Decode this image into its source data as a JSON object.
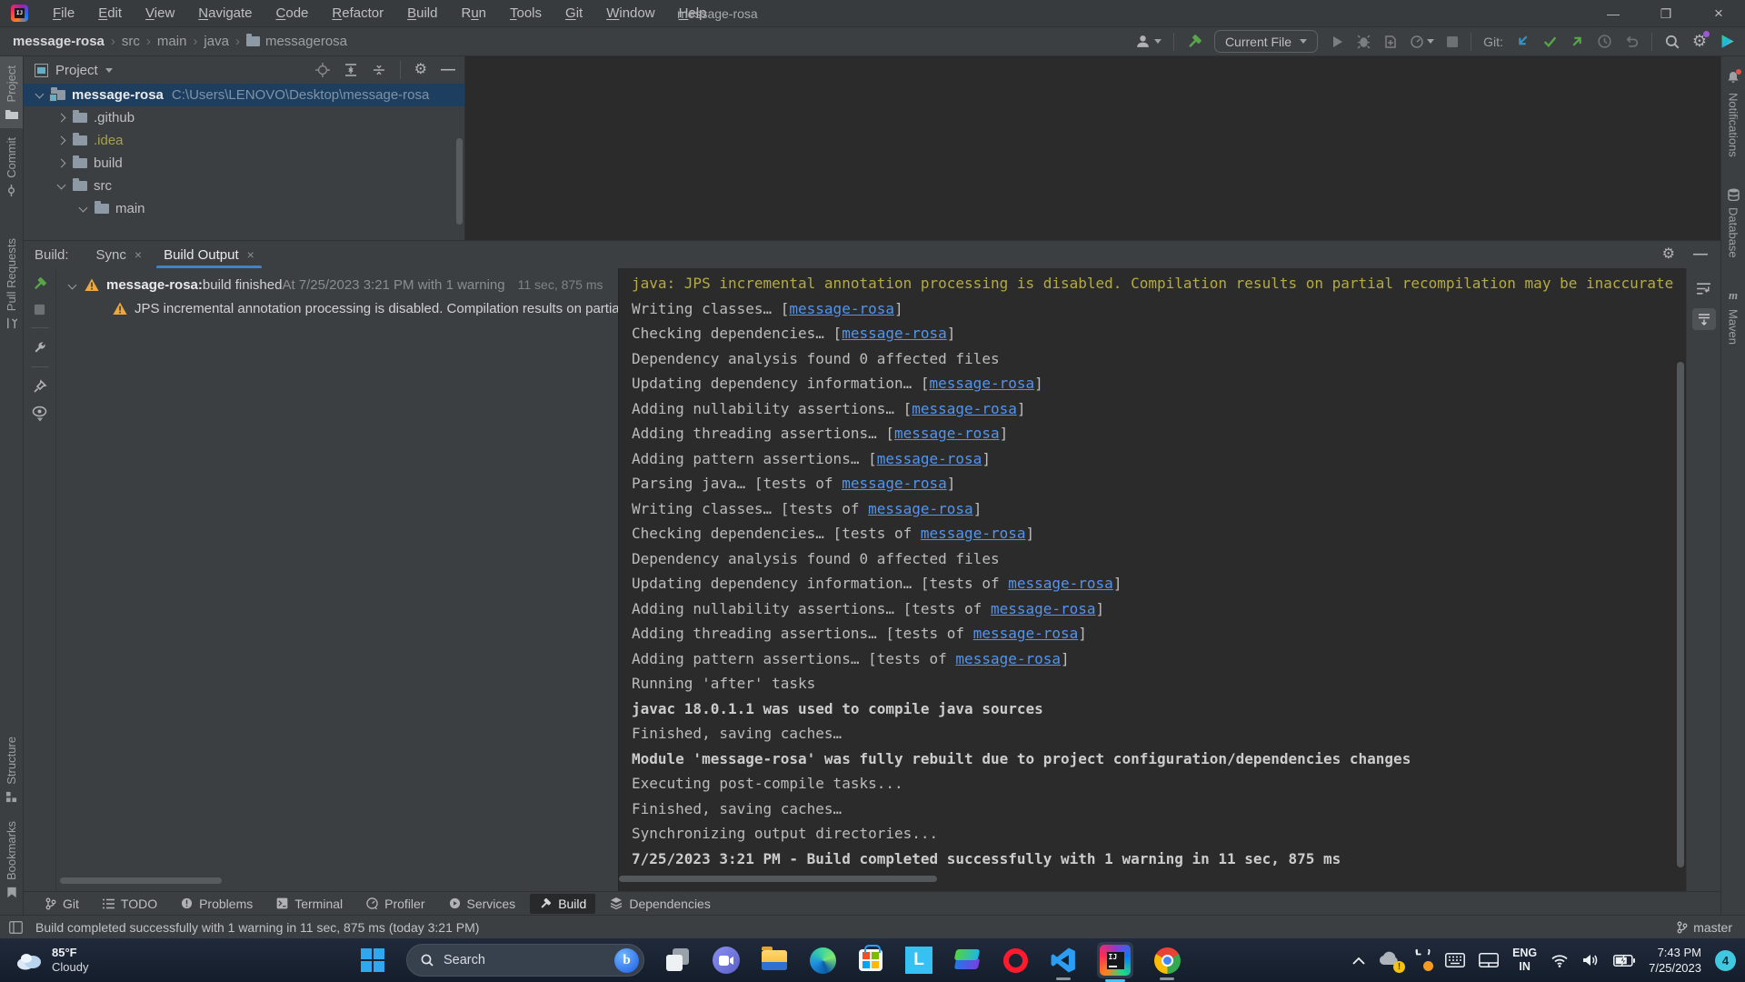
{
  "window": {
    "title": "message-rosa",
    "controls": {
      "minimize": "—",
      "maximize": "❐",
      "close": "×"
    }
  },
  "menu": {
    "items": [
      {
        "label": "File",
        "m": 0
      },
      {
        "label": "Edit",
        "m": 0
      },
      {
        "label": "View",
        "m": 0
      },
      {
        "label": "Navigate",
        "m": 0
      },
      {
        "label": "Code",
        "m": 0
      },
      {
        "label": "Refactor",
        "m": 0
      },
      {
        "label": "Build",
        "m": 0
      },
      {
        "label": "Run",
        "m": 1
      },
      {
        "label": "Tools",
        "m": 0
      },
      {
        "label": "Git",
        "m": 0
      },
      {
        "label": "Window",
        "m": 0
      },
      {
        "label": "Help",
        "m": 0
      }
    ]
  },
  "breadcrumbs": {
    "items": [
      "message-rosa",
      "src",
      "main",
      "java",
      "messagerosa"
    ]
  },
  "toolbar": {
    "run_config": "Current File",
    "git_label": "Git:"
  },
  "left_stripe": {
    "items": [
      "Project",
      "Commit",
      "Pull Requests",
      "Structure",
      "Bookmarks"
    ]
  },
  "right_stripe": {
    "items": [
      "Notifications",
      "Database",
      "Maven"
    ]
  },
  "project_panel": {
    "title": "Project",
    "tree": [
      {
        "label": "message-rosa",
        "path": "C:\\Users\\LENOVO\\Desktop\\message-rosa",
        "indent": 0,
        "chevron": "open",
        "selected": true,
        "bold": true,
        "root": true
      },
      {
        "label": ".github",
        "indent": 1,
        "chevron": "closed"
      },
      {
        "label": ".idea",
        "indent": 1,
        "chevron": "closed",
        "special": true
      },
      {
        "label": "build",
        "indent": 1,
        "chevron": "closed"
      },
      {
        "label": "src",
        "indent": 1,
        "chevron": "open"
      },
      {
        "label": "main",
        "indent": 2,
        "chevron": "open"
      }
    ]
  },
  "build_panel": {
    "label": "Build:",
    "tabs": [
      {
        "label": "Sync",
        "close": "×"
      },
      {
        "label": "Build Output",
        "close": "×",
        "selected": true
      }
    ],
    "tree": {
      "row1_bold": "message-rosa:",
      "row1_normal": " build finished",
      "row1_meta": " At 7/25/2023 3:21 PM with 1 warning",
      "row1_duration": "11 sec, 875 ms",
      "row2_text": "JPS incremental annotation processing is disabled. Compilation results on partia"
    },
    "console": [
      {
        "style": "warn",
        "parts": [
          {
            "t": "java: JPS incremental annotation processing is disabled. Compilation results on partial recompilation may be inaccurate"
          }
        ]
      },
      {
        "parts": [
          {
            "t": "Writing classes… ["
          },
          {
            "l": "message-rosa"
          },
          {
            "t": "]"
          }
        ]
      },
      {
        "parts": [
          {
            "t": "Checking dependencies… ["
          },
          {
            "l": "message-rosa"
          },
          {
            "t": "]"
          }
        ]
      },
      {
        "parts": [
          {
            "t": "Dependency analysis found 0 affected files"
          }
        ]
      },
      {
        "parts": [
          {
            "t": "Updating dependency information… ["
          },
          {
            "l": "message-rosa"
          },
          {
            "t": "]"
          }
        ]
      },
      {
        "parts": [
          {
            "t": "Adding nullability assertions… ["
          },
          {
            "l": "message-rosa"
          },
          {
            "t": "]"
          }
        ]
      },
      {
        "parts": [
          {
            "t": "Adding threading assertions… ["
          },
          {
            "l": "message-rosa"
          },
          {
            "t": "]"
          }
        ]
      },
      {
        "parts": [
          {
            "t": "Adding pattern assertions… ["
          },
          {
            "l": "message-rosa"
          },
          {
            "t": "]"
          }
        ]
      },
      {
        "parts": [
          {
            "t": "Parsing java… [tests of "
          },
          {
            "l": "message-rosa"
          },
          {
            "t": "]"
          }
        ]
      },
      {
        "parts": [
          {
            "t": "Writing classes… [tests of "
          },
          {
            "l": "message-rosa"
          },
          {
            "t": "]"
          }
        ]
      },
      {
        "parts": [
          {
            "t": "Checking dependencies… [tests of "
          },
          {
            "l": "message-rosa"
          },
          {
            "t": "]"
          }
        ]
      },
      {
        "parts": [
          {
            "t": "Dependency analysis found 0 affected files"
          }
        ]
      },
      {
        "parts": [
          {
            "t": "Updating dependency information… [tests of "
          },
          {
            "l": "message-rosa"
          },
          {
            "t": "]"
          }
        ]
      },
      {
        "parts": [
          {
            "t": "Adding nullability assertions… [tests of "
          },
          {
            "l": "message-rosa"
          },
          {
            "t": "]"
          }
        ]
      },
      {
        "parts": [
          {
            "t": "Adding threading assertions… [tests of "
          },
          {
            "l": "message-rosa"
          },
          {
            "t": "]"
          }
        ]
      },
      {
        "parts": [
          {
            "t": "Adding pattern assertions… [tests of "
          },
          {
            "l": "message-rosa"
          },
          {
            "t": "]"
          }
        ]
      },
      {
        "parts": [
          {
            "t": "Running 'after' tasks"
          }
        ]
      },
      {
        "style": "bold",
        "parts": [
          {
            "t": "javac 18.0.1.1 was used to compile java sources"
          }
        ]
      },
      {
        "parts": [
          {
            "t": "Finished, saving caches…"
          }
        ]
      },
      {
        "style": "bold",
        "parts": [
          {
            "t": "Module 'message-rosa' was fully rebuilt due to project configuration/dependencies changes"
          }
        ]
      },
      {
        "parts": [
          {
            "t": "Executing post-compile tasks..."
          }
        ]
      },
      {
        "parts": [
          {
            "t": "Finished, saving caches…"
          }
        ]
      },
      {
        "parts": [
          {
            "t": "Synchronizing output directories..."
          }
        ]
      },
      {
        "style": "bold",
        "parts": [
          {
            "t": "7/25/2023 3:21 PM - Build completed successfully with 1 warning in 11 sec, 875 ms"
          }
        ]
      }
    ]
  },
  "bottom_bar": {
    "items": [
      "Git",
      "TODO",
      "Problems",
      "Terminal",
      "Profiler",
      "Services",
      "Build",
      "Dependencies"
    ],
    "selected": "Build"
  },
  "status_bar": {
    "message": "Build completed successfully with 1 warning in 11 sec, 875 ms (today 3:21 PM)",
    "branch": "master"
  },
  "taskbar": {
    "weather_temp": "85°F",
    "weather_desc": "Cloudy",
    "search_placeholder": "Search",
    "bing_letter": "b",
    "ldplayer_letter": "L",
    "lang_line1": "ENG",
    "lang_line2": "IN",
    "time": "7:43 PM",
    "date": "7/25/2023",
    "notification_count": "4"
  },
  "colors": {
    "panel": "#3c3f41",
    "editor": "#2b2b2b",
    "selection_blue": "#1d3e5e",
    "tab_underline": "#3f83c9",
    "link_blue": "#5394ec",
    "warn_yellow": "#b5ab40",
    "green": "#57a64a",
    "badge_cyan": "#3fc8e0"
  }
}
